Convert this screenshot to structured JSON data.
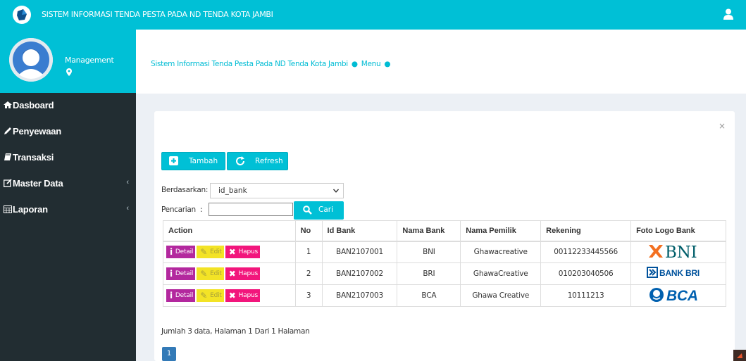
{
  "header": {
    "app_title": "SISTEM INFORMASI TENDA PESTA PADA ND TENDA KOTA JAMBI",
    "user_icon": "user-icon",
    "logo_icon": "app-logo"
  },
  "sidebar": {
    "profile": {
      "role": "Management",
      "location_icon": "map-marker-icon"
    },
    "items": [
      {
        "label": "Dasboard",
        "icon": "home-icon"
      },
      {
        "label": "Penyewaan",
        "icon": "pencil-icon"
      },
      {
        "label": "Transaksi",
        "icon": "book-icon"
      },
      {
        "label": "Master Data",
        "icon": "edit-icon",
        "chevron": "‹"
      },
      {
        "label": "Laporan",
        "icon": "calendar-icon",
        "chevron": "‹"
      }
    ]
  },
  "breadcrumb": {
    "title": "Sistem Informasi Tenda Pesta Pada ND Tenda Kota Jambi",
    "dot": "●",
    "menu": "Menu"
  },
  "box": {
    "close": "×",
    "buttons": {
      "add": "Tambah",
      "refresh": "Refresh"
    },
    "filter": {
      "by_label": "Berdasarkan",
      "by_value": "id_bank",
      "search_label": "Pencarian",
      "search_value": "",
      "search_button": "Cari"
    },
    "table": {
      "columns": [
        "Action",
        "No",
        "Id Bank",
        "Nama Bank",
        "Nama Pemilik",
        "Rekening",
        "Foto Logo Bank"
      ],
      "actions": {
        "detail": "Detail",
        "edit": "Edit",
        "hapus": "Hapus"
      },
      "rows": [
        {
          "no": "1",
          "id": "BAN2107001",
          "bank": "BNI",
          "owner": "Ghawacreative",
          "account": "00112233445566",
          "logo": "BNI"
        },
        {
          "no": "2",
          "id": "BAN2107002",
          "bank": "BRI",
          "owner": "GhawaCreative",
          "account": "010203040506",
          "logo": "BANK BRI"
        },
        {
          "no": "3",
          "id": "BAN2107003",
          "bank": "BCA",
          "owner": "Ghawa Creative",
          "account": "10111213",
          "logo": "BCA"
        }
      ]
    },
    "summary": "Jumlah 3 data, Halaman 1 Dari 1 Halaman",
    "page": "1"
  },
  "colors": {
    "accent": "#00c0d6",
    "sidebar": "#222d32",
    "detail": "#b3289e",
    "edit": "#f3e326",
    "hapus": "#f2167c",
    "pagination": "#337ab7"
  }
}
